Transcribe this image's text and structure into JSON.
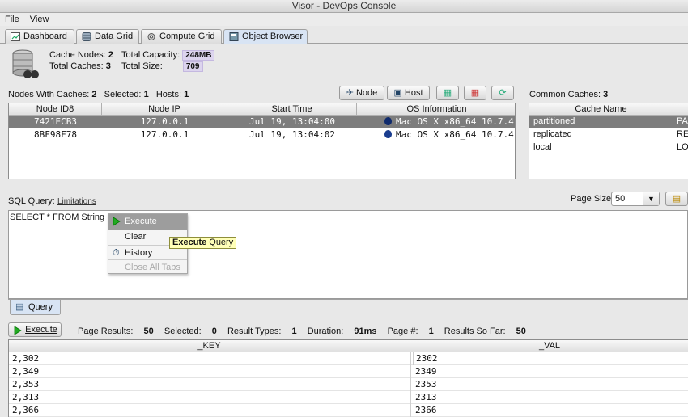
{
  "window": {
    "title": "Visor - DevOps Console"
  },
  "menu": [
    "File",
    "View"
  ],
  "tabs": [
    {
      "label": "Dashboard",
      "icon": "dashboard-icon"
    },
    {
      "label": "Data Grid",
      "icon": "data-grid-icon"
    },
    {
      "label": "Compute Grid",
      "icon": "compute-grid-icon"
    },
    {
      "label": "Object Browser",
      "icon": "object-browser-icon",
      "active": true
    }
  ],
  "summary": {
    "cache_nodes_label": "Cache Nodes:",
    "cache_nodes": "2",
    "total_caches_label": "Total Caches:",
    "total_caches": "3",
    "total_capacity_label": "Total Capacity:",
    "total_capacity": "248MB",
    "total_size_label": "Total Size:",
    "total_size": "709"
  },
  "nodes_bar": {
    "nodes_label": "Nodes With Caches:",
    "nodes": "2",
    "selected_label": "Selected:",
    "selected": "1",
    "hosts_label": "Hosts:",
    "hosts": "1",
    "node_btn": "Node",
    "host_btn": "Host"
  },
  "nodes_table": {
    "headers": [
      "Node ID8",
      "Node IP",
      "Start Time",
      "OS Information"
    ],
    "rows": [
      [
        "7421ECB3",
        "127.0.0.1",
        "Jul 19, 13:04:00",
        "Mac OS X x86_64 10.7.4"
      ],
      [
        "8BF98F78",
        "127.0.0.1",
        "Jul 19, 13:04:02",
        "Mac OS X x86_64 10.7.4"
      ]
    ]
  },
  "caches": {
    "label": "Common Caches:",
    "count": "3",
    "header": "Cache Name",
    "rows": [
      [
        "partitioned",
        "PAR"
      ],
      [
        "replicated",
        "REP"
      ],
      [
        "local",
        "LOC"
      ]
    ]
  },
  "sql": {
    "label": "SQL Query:",
    "limitations": "Limitations",
    "page_size_label": "Page Size:",
    "page_size": "50",
    "query_text": "SELECT * FROM String"
  },
  "context_menu": {
    "execute": "Execute",
    "clear": "Clear",
    "history": "History",
    "close_all": "Close All Tabs"
  },
  "tooltip": {
    "bold": "Execute",
    "rest": " Query"
  },
  "query_tab": "Query",
  "results_bar": {
    "execute_btn": "Execute",
    "page_results_label": "Page Results:",
    "page_results": "50",
    "selected_label": "Selected:",
    "selected": "0",
    "result_types_label": "Result Types:",
    "result_types": "1",
    "duration_label": "Duration:",
    "duration": "91ms",
    "page_label": "Page #:",
    "page": "1",
    "so_far_label": "Results So Far:",
    "so_far": "50"
  },
  "results_table": {
    "headers": [
      "_KEY",
      "_VAL"
    ],
    "rows": [
      [
        "2,302",
        "2302"
      ],
      [
        "2,349",
        "2349"
      ],
      [
        "2,353",
        "2353"
      ],
      [
        "2,313",
        "2313"
      ],
      [
        "2,366",
        "2366"
      ]
    ]
  }
}
